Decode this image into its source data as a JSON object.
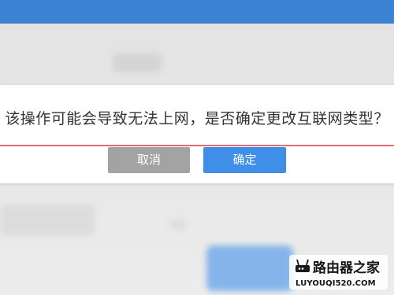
{
  "dialog": {
    "message": "该操作可能会导致无法上网，是否确定更改互联网类型？",
    "cancel_label": "取消",
    "confirm_label": "确定"
  },
  "colors": {
    "accent": "#3f8fe8",
    "top_bar": "#3d83d3",
    "cancel": "#a3a3a3",
    "divider": "#e4686d"
  },
  "watermark": {
    "title": "路由器之家",
    "url": "LUYOUQI520.COM"
  }
}
